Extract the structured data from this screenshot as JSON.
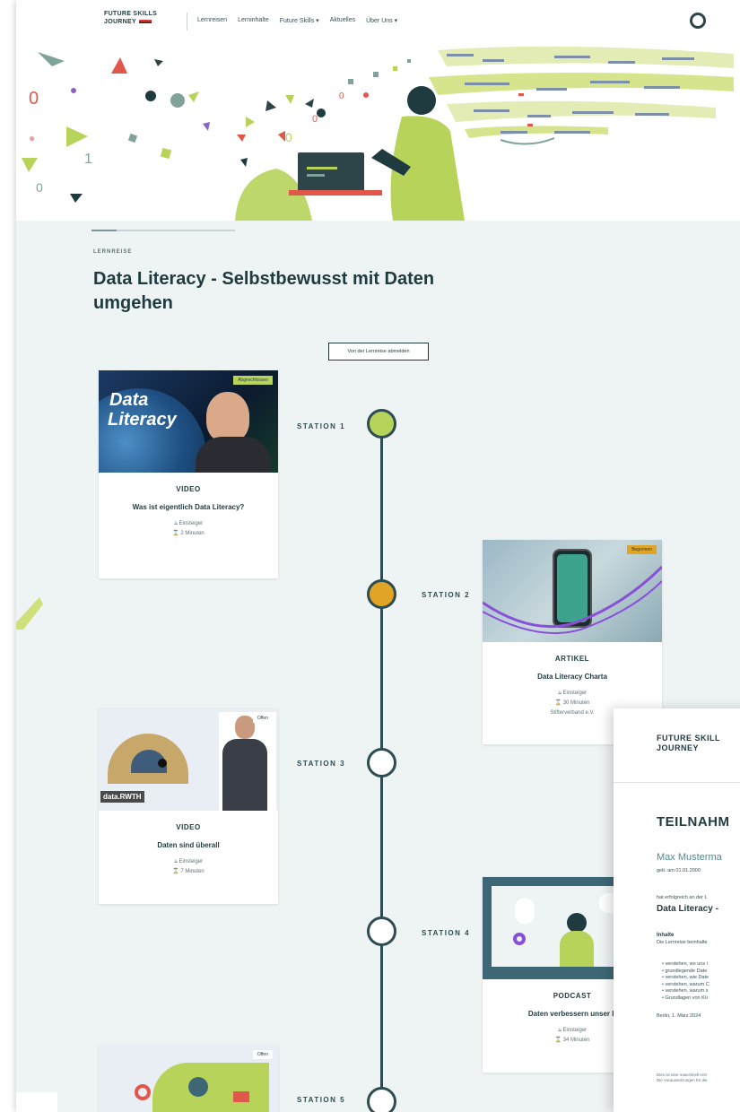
{
  "nav": {
    "logo_line1": "FUTURE SKILLS",
    "logo_line2": "JOURNEY",
    "links": [
      "Lernreisen",
      "Lerninhalte",
      "Future Skills ▾",
      "Aktuelles",
      "Über Uns ▾"
    ]
  },
  "eyebrow": "LERNREISE",
  "title": "Data Literacy - Selbstbewusst mit Daten umgehen",
  "unsubscribe_label": "Von der Lernreise abmelden",
  "colors": {
    "accent_green": "#b7d35a",
    "accent_orange": "#e2a424",
    "dark_teal": "#2d4d52",
    "background": "#eef3f4"
  },
  "stations": [
    {
      "label": "STATION 1",
      "state": "completed"
    },
    {
      "label": "STATION 2",
      "state": "in-progress"
    },
    {
      "label": "STATION 3",
      "state": "open"
    },
    {
      "label": "STATION 4",
      "state": "open"
    },
    {
      "label": "STATION 5",
      "state": "open"
    }
  ],
  "cards": [
    {
      "type": "VIDEO",
      "title": "Was ist eigentlich Data Literacy?",
      "level": "Einsteiger",
      "duration": "2 Minuten",
      "badge": "Abgeschlossen",
      "thumb_text_1": "Data",
      "thumb_text_2": "Literacy"
    },
    {
      "type": "ARTIKEL",
      "title": "Data Literacy Charta",
      "level": "Einsteiger",
      "duration": "30 Minuten",
      "source": "Stifterverband e.V.",
      "badge": "Begonnen"
    },
    {
      "type": "VIDEO",
      "title": "Daten sind überall",
      "level": "Einsteiger",
      "duration": "7 Minuten",
      "badge": "Offen",
      "thumb_text_1": "data.RWTH"
    },
    {
      "type": "PODCAST",
      "title": "Daten verbessern unser L",
      "level": "Einsteiger",
      "duration": "34 Minuten"
    },
    {
      "badge": "Offen"
    }
  ],
  "certificate": {
    "logo_line1": "FUTURE SKILL",
    "logo_line2": "JOURNEY",
    "heading": "TEILNAHM",
    "name": "Max Musterma",
    "dob": "geb. am 01.01.2000",
    "completed_text": "hat erfolgreich an der L",
    "course": "Data Literacy -",
    "contents_heading": "Inhalte",
    "contents_intro": "Die Lernreise beinhalte",
    "items": [
      "verstehen, wo uns i",
      "grundlegende Date",
      "verstehen, wie Date",
      "verstehen, warum C",
      "verstehen, warum s",
      "Grundlagen von Kü"
    ],
    "date": "Berlin, 1. März 2024",
    "footer_1": "Dies ist eine maschinell erst",
    "footer_2": "Die Voraussetzungen für die"
  }
}
